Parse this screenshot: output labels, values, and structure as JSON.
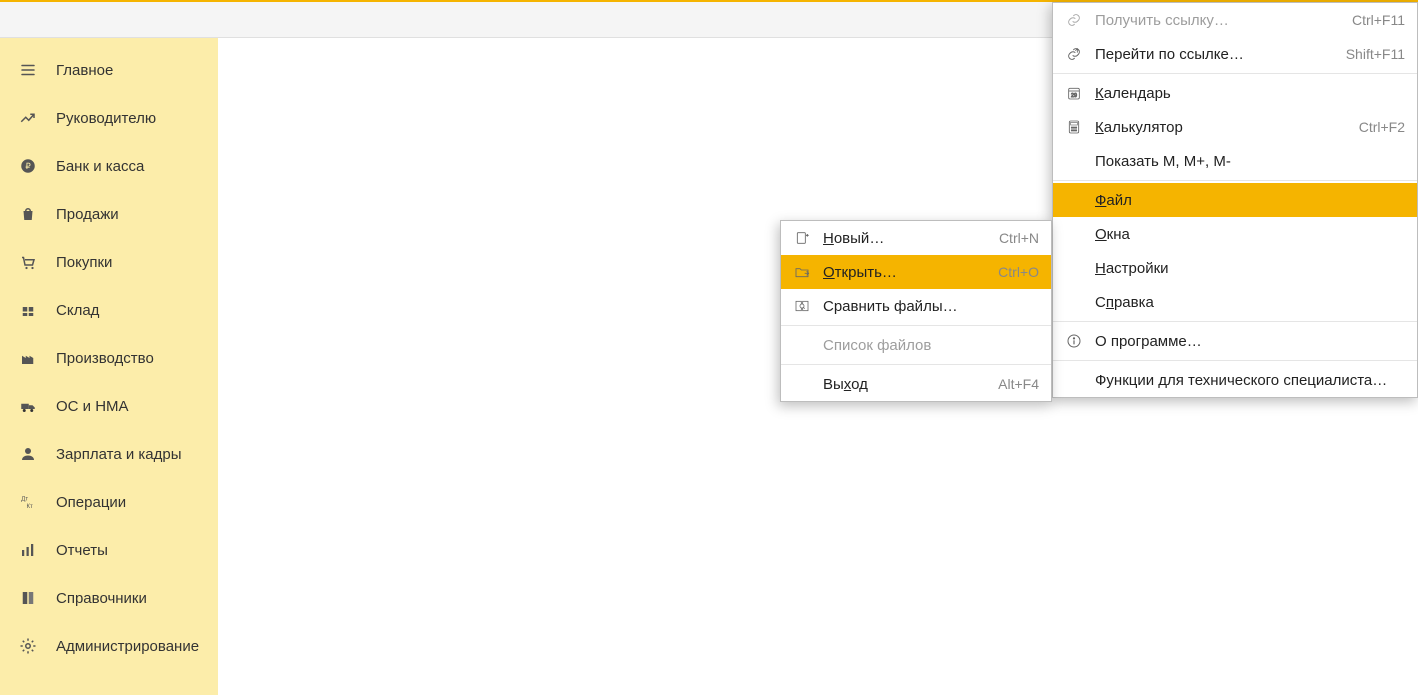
{
  "colors": {
    "accent": "#f5b400",
    "sidebar": "#fcedaa"
  },
  "sidebar": {
    "items": [
      {
        "label": "Главное",
        "icon": "menu"
      },
      {
        "label": "Руководителю",
        "icon": "trend"
      },
      {
        "label": "Банк и касса",
        "icon": "ruble"
      },
      {
        "label": "Продажи",
        "icon": "bag"
      },
      {
        "label": "Покупки",
        "icon": "cart"
      },
      {
        "label": "Склад",
        "icon": "warehouse"
      },
      {
        "label": "Производство",
        "icon": "factory"
      },
      {
        "label": "ОС и НМА",
        "icon": "truck"
      },
      {
        "label": "Зарплата и кадры",
        "icon": "person"
      },
      {
        "label": "Операции",
        "icon": "dtkt"
      },
      {
        "label": "Отчеты",
        "icon": "barchart"
      },
      {
        "label": "Справочники",
        "icon": "books"
      },
      {
        "label": "Администрирование",
        "icon": "gear"
      }
    ]
  },
  "tools_menu": {
    "items": [
      {
        "label": "Получить ссылку…",
        "icon": "link",
        "shortcut": "Ctrl+F11",
        "disabled": true
      },
      {
        "label": "Перейти по ссылке…",
        "icon": "goto",
        "shortcut": "Shift+F11"
      },
      {
        "sep": true
      },
      {
        "label": "Календарь",
        "icon": "calendar",
        "underline_index": 0
      },
      {
        "label": "Калькулятор",
        "icon": "calc",
        "shortcut": "Ctrl+F2",
        "underline_index": 0
      },
      {
        "label": "Показать M, M+, M-"
      },
      {
        "sep": true
      },
      {
        "label": "Файл",
        "highlight": true,
        "submenu": "file",
        "underline_index": 0
      },
      {
        "label": "Окна",
        "underline_index": 0
      },
      {
        "label": "Настройки",
        "underline_index": 0
      },
      {
        "label": "Справка",
        "underline_index": 1
      },
      {
        "sep": true
      },
      {
        "label": "О программе…",
        "icon": "info"
      },
      {
        "sep": true
      },
      {
        "label": "Функции для технического специалиста…"
      }
    ]
  },
  "file_submenu": {
    "items": [
      {
        "label": "Новый…",
        "icon": "new",
        "shortcut": "Ctrl+N",
        "underline_index": 0
      },
      {
        "label": "Открыть…",
        "icon": "open",
        "shortcut": "Ctrl+O",
        "underline_index": 0,
        "highlight": true
      },
      {
        "label": "Сравнить файлы…",
        "icon": "compare"
      },
      {
        "sep": true
      },
      {
        "label": "Список файлов",
        "disabled": true
      },
      {
        "sep": true
      },
      {
        "label": "Выход",
        "shortcut": "Alt+F4",
        "underline_index": 2
      }
    ]
  }
}
